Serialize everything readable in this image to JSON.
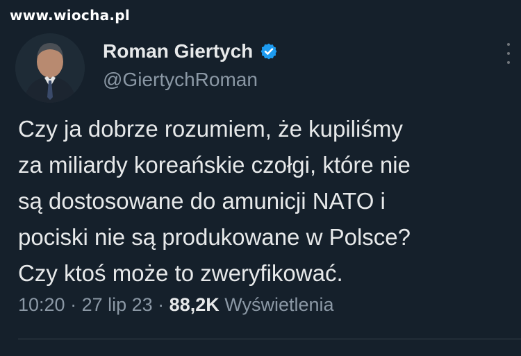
{
  "watermark": "www.wiocha.pl",
  "author": {
    "display_name": "Roman Giertych",
    "handle": "@GiertychRoman",
    "verified": true,
    "avatar": "avatar-photo"
  },
  "tweet": {
    "lines": [
      "Czy ja dobrze rozumiem, że kupiliśmy",
      "za miliardy koreańskie czołgi, które nie",
      "są dostosowane do amunicji NATO i",
      "pociski nie są produkowane w Polsce?",
      "Czy ktoś może to zweryfikować."
    ]
  },
  "meta": {
    "time": "10:20",
    "separator": " · ",
    "date": "27 lip 23",
    "views_count": "88,2K",
    "views_label": "Wyświetlenia"
  },
  "icons": {
    "verified": "verified-badge-icon",
    "more": "more-options-icon"
  },
  "colors": {
    "background": "#15202b",
    "text": "#e7e9ea",
    "secondary_text": "#8b98a5",
    "verified_badge": "#1d9bf0"
  }
}
